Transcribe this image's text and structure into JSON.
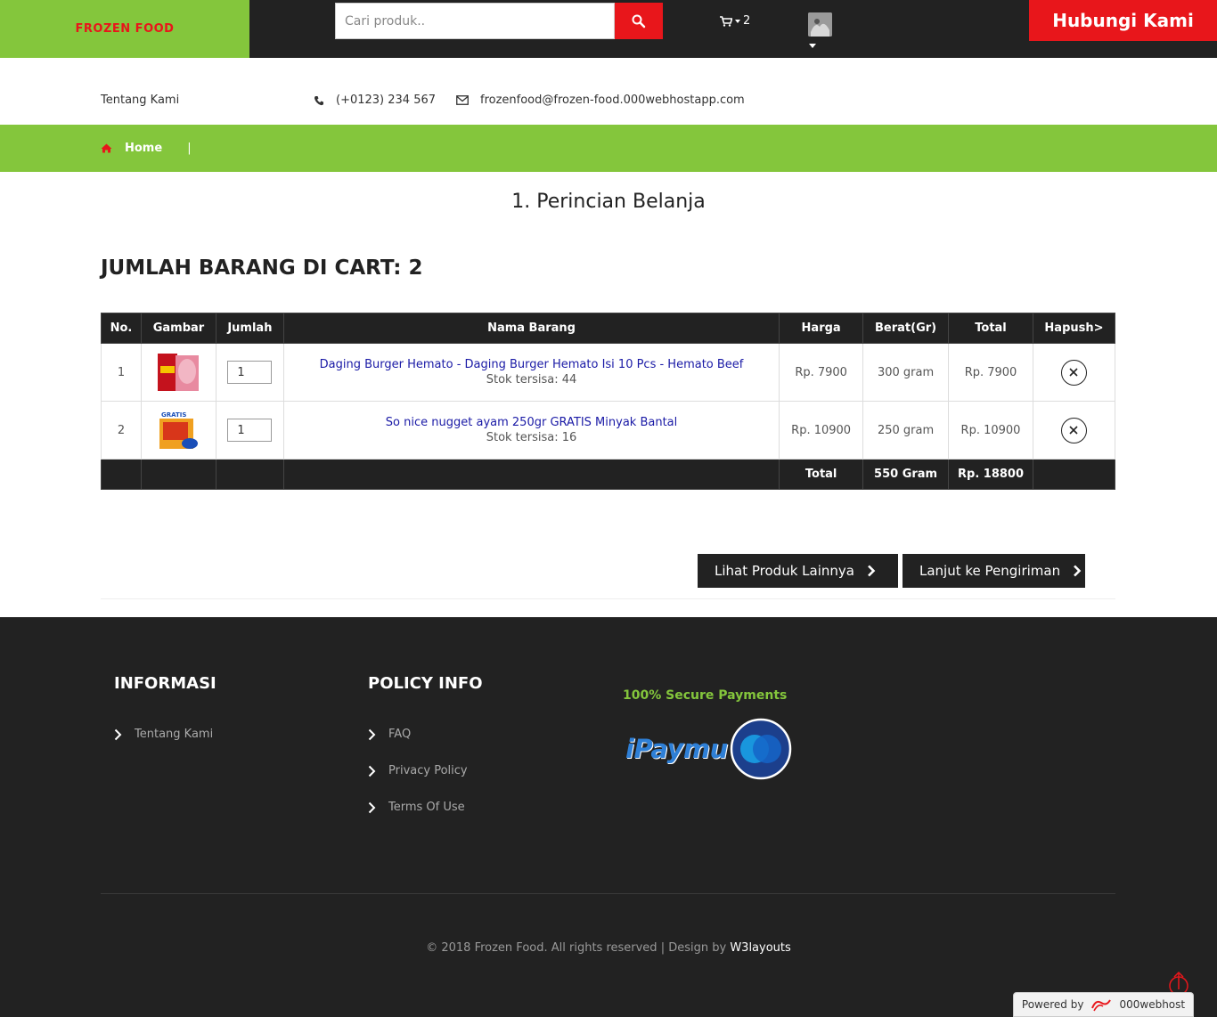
{
  "header": {
    "logo": "FROZEN FOOD",
    "search_placeholder": "Cari produk..",
    "cart_count": "2",
    "contact_button": "Hubungi Kami"
  },
  "info": {
    "about": "Tentang Kami",
    "phone": "(+0123) 234 567",
    "email": "frozenfood@frozen-food.000webhostapp.com"
  },
  "breadcrumb": {
    "home": "Home",
    "separator": "|"
  },
  "main": {
    "title": "1. Perincian Belanja",
    "cart_heading": "JUMLAH BARANG DI CART: 2"
  },
  "table": {
    "headers": [
      "No.",
      "Gambar",
      "Jumlah",
      "Nama Barang",
      "Harga",
      "Berat(Gr)",
      "Total",
      "Hapush>"
    ],
    "rows": [
      {
        "no": "1",
        "qty": "1",
        "name": "Daging Burger Hemato - Daging Burger Hemato Isi 10 Pcs - Hemato Beef",
        "stock": "Stok tersisa: 44",
        "price": "Rp. 7900",
        "weight": "300 gram",
        "total": "Rp. 7900"
      },
      {
        "no": "2",
        "qty": "1",
        "name": "So nice nugget ayam 250gr GRATIS Minyak Bantal",
        "stock": "Stok tersisa: 16",
        "price": "Rp. 10900",
        "weight": "250 gram",
        "total": "Rp. 10900"
      }
    ],
    "footer": {
      "label": "Total",
      "weight": "550 Gram",
      "amount": "Rp. 18800"
    }
  },
  "actions": {
    "more_products": "Lihat Produk Lainnya",
    "continue_shipping": "Lanjut ke Pengiriman"
  },
  "footer": {
    "info_heading": "INFORMASI",
    "info_links": [
      "Tentang Kami"
    ],
    "policy_heading": "POLICY INFO",
    "policy_links": [
      "FAQ",
      "Privacy Policy",
      "Terms Of Use"
    ],
    "secure_payments": "100% Secure Payments",
    "payment_brand": "iPaymu",
    "copyright": "© 2018 Frozen Food. All rights reserved | Design by",
    "designer": "W3layouts"
  },
  "badge": {
    "powered_by": "Powered by",
    "host": "000webhost"
  },
  "colors": {
    "accent_green": "#84c63c",
    "accent_red": "#e8161b",
    "dark": "#222222",
    "link_blue": "#1a1aa6"
  }
}
